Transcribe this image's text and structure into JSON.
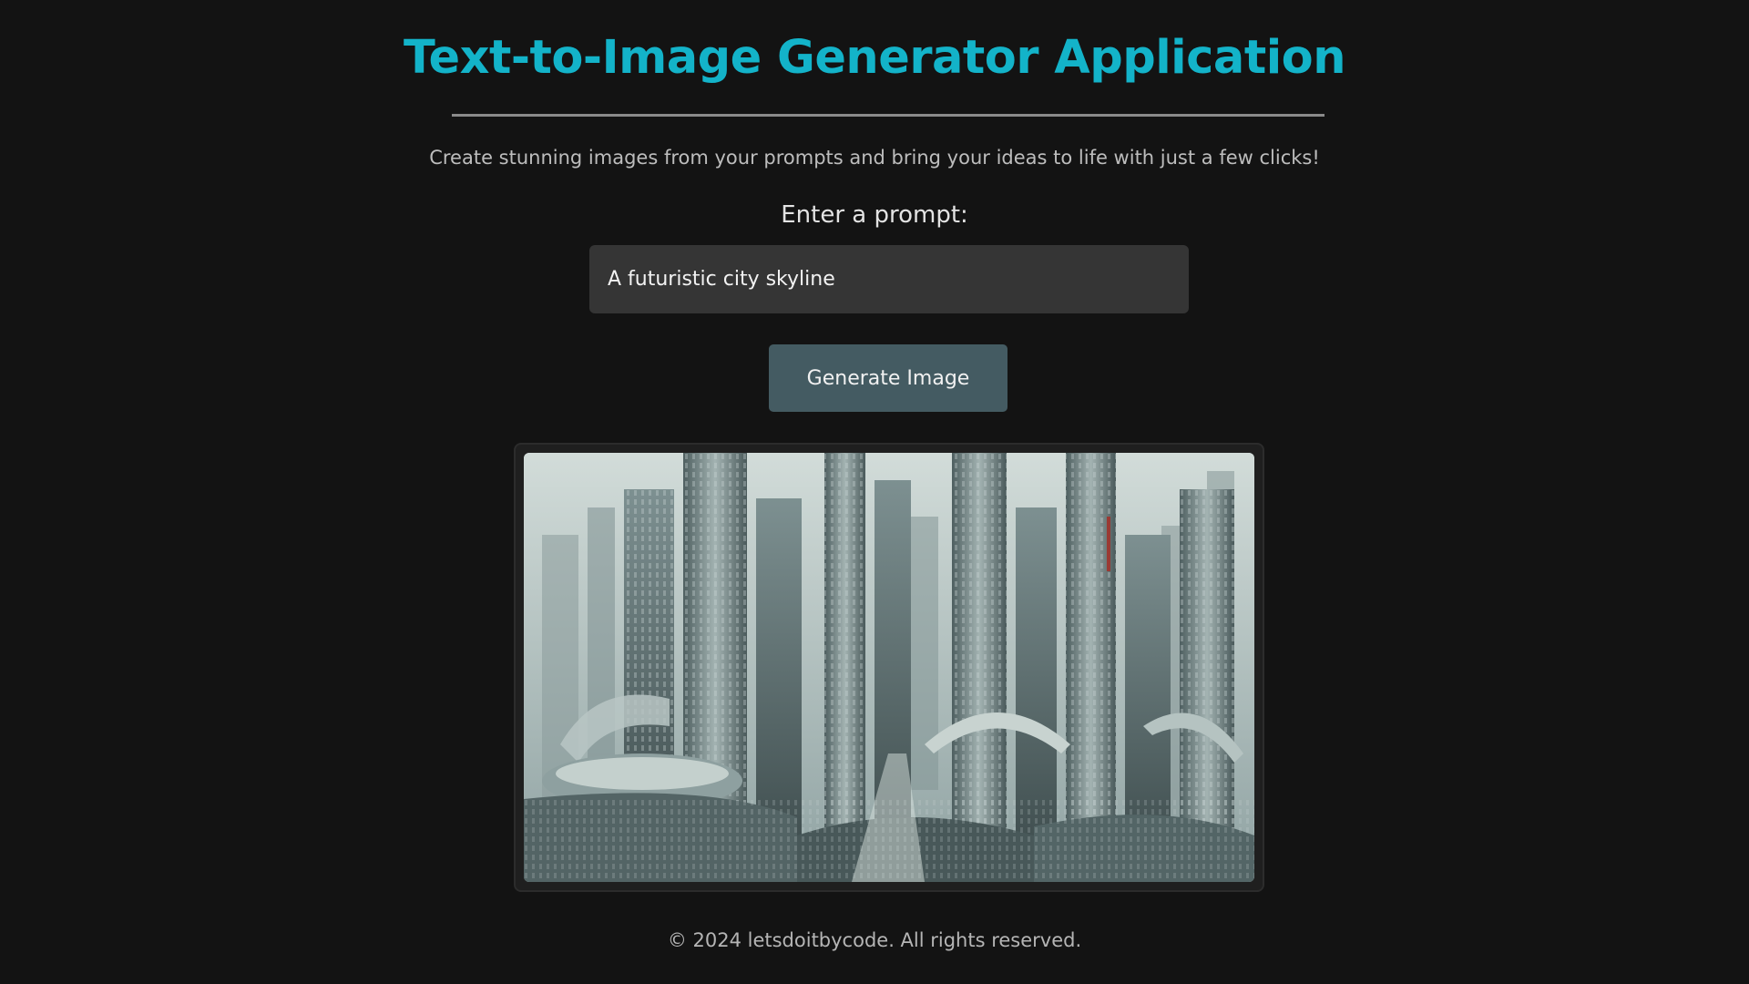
{
  "app": {
    "title": "Text-to-Image Generator Application",
    "subtitle": "Create stunning images from your prompts and bring your ideas to life with just a few clicks!"
  },
  "prompt": {
    "label": "Enter a prompt:",
    "value": "A futuristic city skyline"
  },
  "generate_button": {
    "label": "Generate Image"
  },
  "result_image": {
    "alt": "generated futuristic city skyline image"
  },
  "footer": {
    "text": "© 2024 letsdoitbycode. All rights reserved."
  },
  "colors": {
    "background": "#131313",
    "accent": "#13b3c9",
    "input_bg": "#353535",
    "button_bg": "#445b62"
  }
}
